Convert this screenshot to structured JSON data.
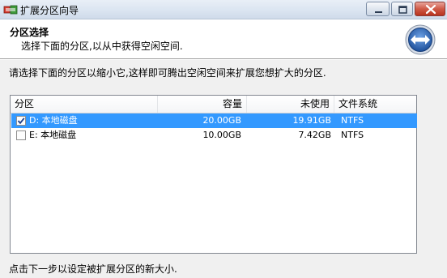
{
  "window": {
    "title": "扩展分区向导",
    "icon": "partition-wizard-app-icon",
    "controls": [
      "minimize-icon",
      "maximize-icon",
      "close-icon"
    ]
  },
  "header": {
    "title": "分区选择",
    "subtitle": "选择下面的分区,以从中获得空闲空间.",
    "icon": "wizard-double-arrow-icon"
  },
  "instruction": "请选择下面的分区以缩小它,这样即可腾出空闲空间来扩展您想扩大的分区.",
  "table": {
    "columns": [
      "分区",
      "容量",
      "未使用",
      "文件系统"
    ],
    "rows": [
      {
        "checked": true,
        "selected": true,
        "name": "D: 本地磁盘",
        "capacity": "20.00GB",
        "free": "19.91GB",
        "fs": "NTFS"
      },
      {
        "checked": false,
        "selected": false,
        "name": "E: 本地磁盘",
        "capacity": "10.00GB",
        "free": "7.42GB",
        "fs": "NTFS"
      }
    ]
  },
  "footer": "点击下一步以设定被扩展分区的新大小.",
  "colors": {
    "selection": "#3399ff",
    "titlebar": "#dbe5f1",
    "close_button": "#c9473a",
    "background": "#f0f0f0"
  }
}
